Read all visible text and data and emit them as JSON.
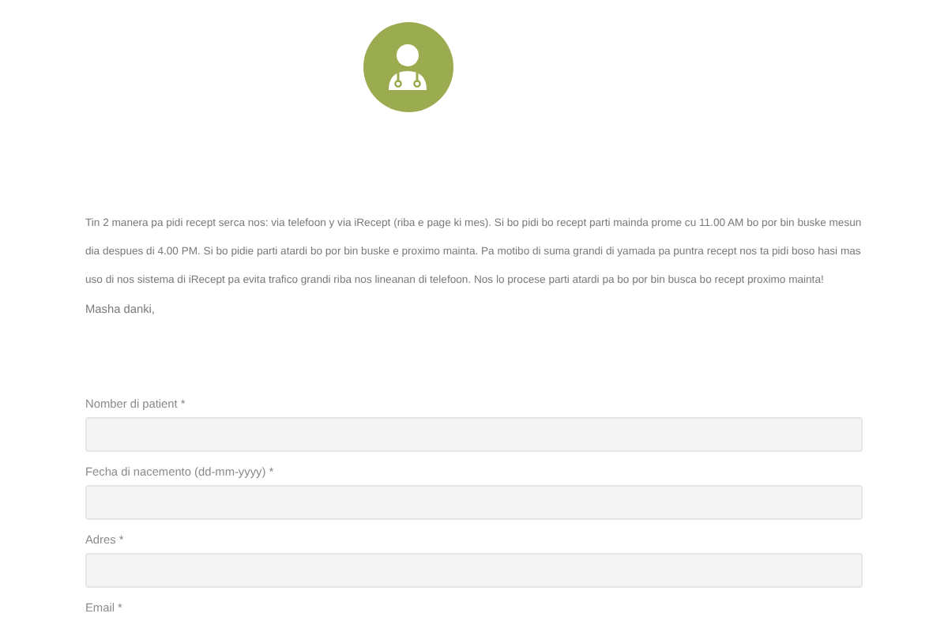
{
  "intro": {
    "paragraph": "Tin 2 manera pa pidi recept serca nos: via telefoon y via iRecept (riba e page ki mes). Si bo pidi bo recept parti mainda prome cu 11.00 AM bo por bin buske mesun dia despues di 4.00 PM. Si bo pidie parti atardi bo por bin buske e proximo mainta. Pa motibo di suma grandi di yamada pa puntra recept nos ta pidi boso hasi mas uso di nos sistema di iRecept pa evita trafico grandi riba nos lineanan di telefoon. Nos lo procese parti atardi pa bo por bin busca bo recept proximo mainta!",
    "closing": "Masha danki,"
  },
  "form": {
    "fields": [
      {
        "label": "Nomber di patient *",
        "kind": "input"
      },
      {
        "label": "Fecha di nacemento (dd-mm-yyyy) *",
        "kind": "input"
      },
      {
        "label": "Adres *",
        "kind": "input"
      },
      {
        "label": "Email *",
        "kind": "label_only"
      }
    ]
  }
}
